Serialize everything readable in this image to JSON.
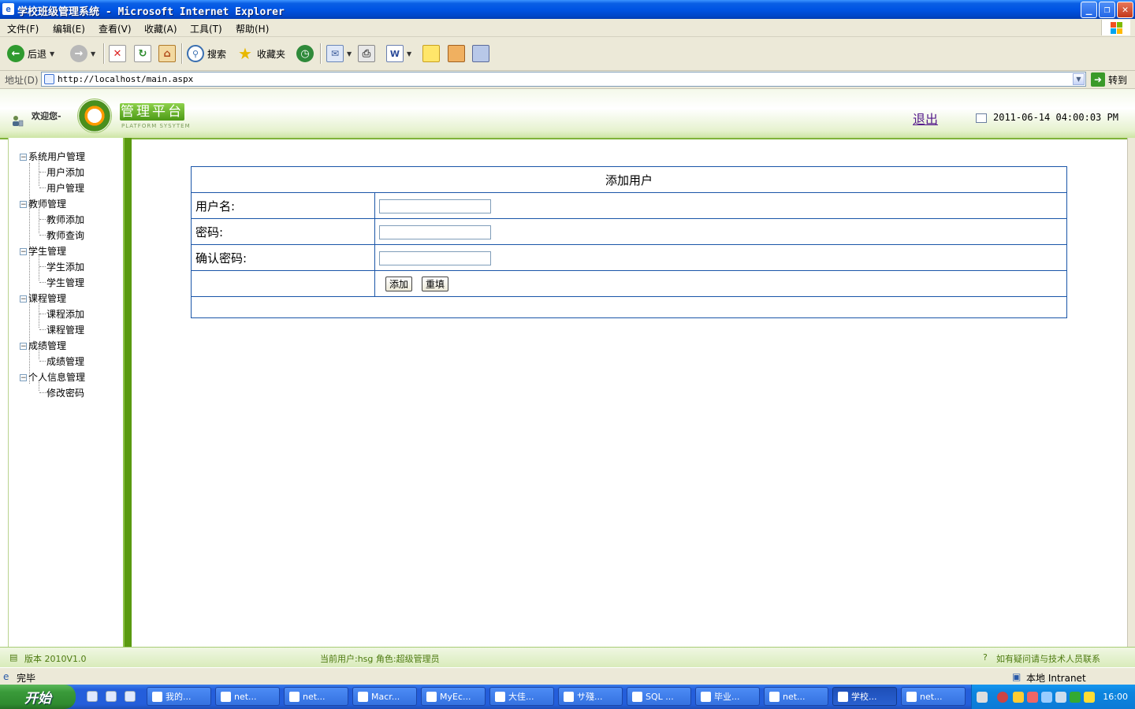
{
  "window": {
    "title": "学校班级管理系统 - Microsoft Internet Explorer",
    "minimize": "_",
    "maximize": "❐",
    "close": "✕"
  },
  "menu": [
    "文件(F)",
    "编辑(E)",
    "查看(V)",
    "收藏(A)",
    "工具(T)",
    "帮助(H)"
  ],
  "toolbar": {
    "back_label": "后退",
    "search_label": "搜索",
    "favorites_label": "收藏夹"
  },
  "address": {
    "label": "地址(D)",
    "url": "http://localhost/main.aspx",
    "go_label": "转到"
  },
  "header": {
    "welcome": "欢迎您-",
    "platform_title": "管理平台",
    "platform_subtitle": "PLATFORM SYSYTEM",
    "logout": "退出",
    "datetime": "2011-06-14 04:00:03 PM"
  },
  "tree": [
    {
      "label": "系统用户管理",
      "children": [
        "用户添加",
        "用户管理"
      ]
    },
    {
      "label": "教师管理",
      "children": [
        "教师添加",
        "教师查询"
      ]
    },
    {
      "label": "学生管理",
      "children": [
        "学生添加",
        "学生管理"
      ]
    },
    {
      "label": "课程管理",
      "children": [
        "课程添加",
        "课程管理"
      ]
    },
    {
      "label": "成绩管理",
      "children": [
        "成绩管理"
      ]
    },
    {
      "label": "个人信息管理",
      "children": [
        "修改密码"
      ]
    }
  ],
  "form": {
    "title": "添加用户",
    "username_label": "用户名:",
    "password_label": "密码:",
    "confirm_label": "确认密码:",
    "username_value": "",
    "password_value": "",
    "confirm_value": "",
    "add_button": "添加",
    "reset_button": "重填"
  },
  "footer": {
    "version": "版本 2010V1.0",
    "current_user": "当前用户:hsg 角色:超级管理员",
    "contact": "如有疑问请与技术人员联系"
  },
  "status": {
    "left": "完毕",
    "zone": "本地 Intranet"
  },
  "taskbar": {
    "start": "开始",
    "tasks": [
      "我的...",
      "net...",
      "net...",
      "Macr...",
      "MyEc...",
      "大佳...",
      "サ殘...",
      "SQL ...",
      "毕业...",
      "net...",
      "学校...",
      "net..."
    ],
    "clock": "16:00"
  },
  "colors": {
    "accent_green": "#5a9a10",
    "link_purple": "#551a8b",
    "table_border": "#1a55a8",
    "titlebar_blue": "#0054e3"
  }
}
